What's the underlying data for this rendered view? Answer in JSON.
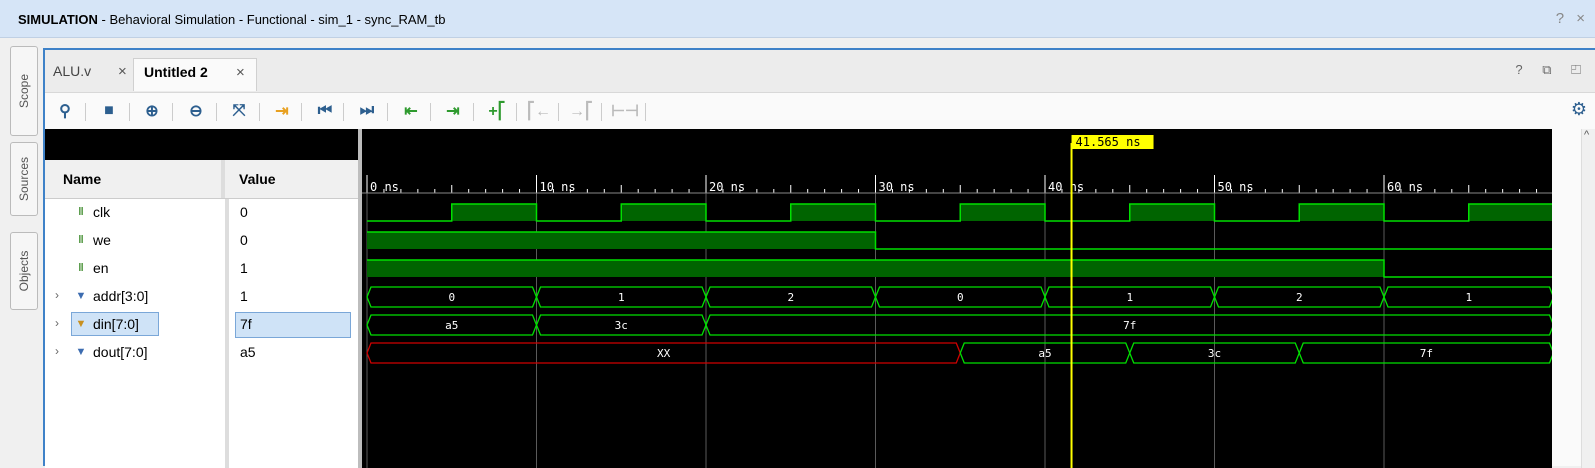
{
  "window": {
    "title_bold": "SIMULATION",
    "title_rest": " - Behavioral Simulation - Functional - sim_1 - sync_RAM_tb",
    "controls": "? ×"
  },
  "side_tabs": [
    "Scope",
    "Sources",
    "Objects"
  ],
  "tabs": [
    {
      "label": "ALU.v",
      "active": false
    },
    {
      "label": "Untitled 2",
      "active": true
    }
  ],
  "toolbar_icons": [
    "search-icon",
    "save-icon",
    "zoom-in-icon",
    "zoom-out-icon",
    "zoom-fit-icon",
    "go-to-cursor-icon",
    "go-to-time-0-icon",
    "go-to-last-time-icon",
    "previous-transition-icon",
    "next-transition-icon",
    "add-marker-icon",
    "previous-marker-icon",
    "next-marker-icon",
    "swap-cursors-icon"
  ],
  "wave_panel": {
    "name_header": "Name",
    "value_header": "Value",
    "cursor_label": "41.565 ns",
    "cursor_time_ns": 41.565,
    "time_ticks": [
      "0 ns",
      "10 ns",
      "20 ns",
      "30 ns",
      "40 ns",
      "50 ns",
      "60 ns"
    ],
    "signals": [
      {
        "name": "clk",
        "value": "0",
        "kind": "bit",
        "expandable": false
      },
      {
        "name": "we",
        "value": "0",
        "kind": "bit",
        "expandable": false
      },
      {
        "name": "en",
        "value": "1",
        "kind": "bit",
        "expandable": false
      },
      {
        "name": "addr[3:0]",
        "value": "1",
        "kind": "bus",
        "expandable": true
      },
      {
        "name": "din[7:0]",
        "value": "7f",
        "kind": "bus",
        "expandable": true,
        "selected": true
      },
      {
        "name": "dout[7:0]",
        "value": "a5",
        "kind": "bus",
        "expandable": true
      }
    ],
    "waves": {
      "clk_period_ns": 10,
      "clk_high_start_ns": 5,
      "we": [
        {
          "from": 0,
          "to": 30,
          "level": 1
        },
        {
          "from": 30,
          "to": 70,
          "level": 0
        }
      ],
      "en": [
        {
          "from": 0,
          "to": 60,
          "level": 1
        },
        {
          "from": 60,
          "to": 70,
          "level": 0
        }
      ],
      "addr": [
        {
          "from": 0,
          "to": 10,
          "text": "0"
        },
        {
          "from": 10,
          "to": 20,
          "text": "1"
        },
        {
          "from": 20,
          "to": 30,
          "text": "2"
        },
        {
          "from": 30,
          "to": 40,
          "text": "0"
        },
        {
          "from": 40,
          "to": 50,
          "text": "1"
        },
        {
          "from": 50,
          "to": 60,
          "text": "2"
        },
        {
          "from": 60,
          "to": 70,
          "text": "1"
        }
      ],
      "din": [
        {
          "from": 0,
          "to": 10,
          "text": "a5"
        },
        {
          "from": 10,
          "to": 20,
          "text": "3c"
        },
        {
          "from": 20,
          "to": 70,
          "text": "7f"
        }
      ],
      "dout": [
        {
          "from": 0,
          "to": 35,
          "text": "XX",
          "undefined": true
        },
        {
          "from": 35,
          "to": 45,
          "text": "a5"
        },
        {
          "from": 45,
          "to": 55,
          "text": "3c"
        },
        {
          "from": 55,
          "to": 70,
          "text": "7f"
        }
      ]
    }
  },
  "colors": {
    "wave_green": "#00e000",
    "wave_fill": "#006400",
    "undefined_red": "#d00000",
    "cursor_yellow": "#ffff00",
    "accent_blue": "#3f82c8"
  }
}
